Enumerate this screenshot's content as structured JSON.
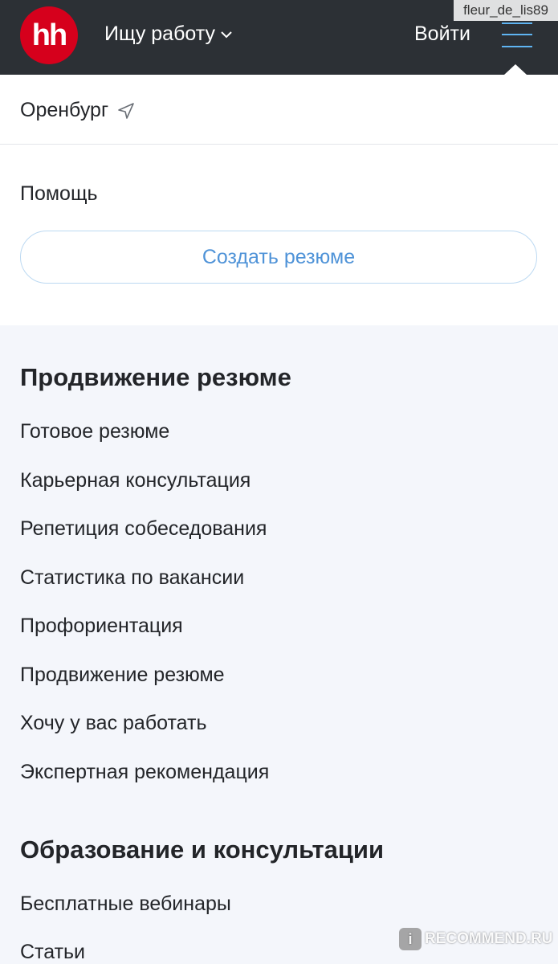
{
  "header": {
    "logo_text": "hh",
    "job_switch_label": "Ищу работу",
    "login_label": "Войти",
    "watermark_user": "fleur_de_lis89"
  },
  "panel": {
    "city": "Оренбург",
    "help": "Помощь",
    "create_resume": "Создать резюме"
  },
  "sections": [
    {
      "title": "Продвижение резюме",
      "items": [
        "Готовое резюме",
        "Карьерная консультация",
        "Репетиция собеседования",
        "Статистика по вакансии",
        "Профориентация",
        "Продвижение резюме",
        "Хочу у вас работать",
        "Экспертная рекомендация"
      ]
    },
    {
      "title": "Образование и консультации",
      "items": [
        "Бесплатные вебинары",
        "Статьи"
      ]
    }
  ],
  "watermark_site": "RECOMMEND.RU",
  "colors": {
    "header_bg": "#2c3035",
    "logo_red": "#d6001c",
    "accent_blue": "#4f93d8",
    "burger_blue": "#5fb4f2",
    "page_bg": "#f4f6fb"
  }
}
